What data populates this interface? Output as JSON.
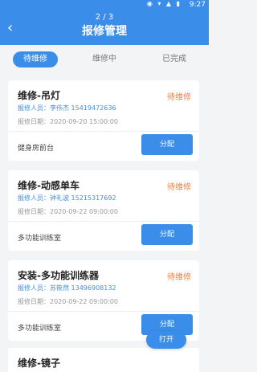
{
  "statusbar": {
    "time": "9:27",
    "icons": "◉ ▾ ▲ ▮"
  },
  "header": {
    "back_icon": "‹",
    "pager": "2 / 3",
    "title": "报修管理"
  },
  "tabs": [
    {
      "label": "待维修"
    },
    {
      "label": "维修中"
    },
    {
      "label": "已完成"
    }
  ],
  "cards": [
    {
      "name": "维修-吊灯",
      "status": "待维修",
      "reporter": "报修人员：李伟杰 15419472636",
      "date": "报修日期：2020-09-20 15:00:00",
      "location": "健身房前台",
      "assign": "分配"
    },
    {
      "name": "维修-动感单车",
      "status": "待维修",
      "reporter": "报修人员：钟礼波 15215317692",
      "date": "报修日期：2020-09-22 09:00:00",
      "location": "多功能训练室",
      "assign": "分配"
    },
    {
      "name": "安装-多功能训练器",
      "status": "待维修",
      "reporter": "报修人员：苏筱然 13496908132",
      "date": "报修日期：2020-09-22 09:00:00",
      "location": "多功能训练室",
      "assign": "分配"
    },
    {
      "name": "维修-镜子"
    }
  ],
  "fab": {
    "label": "打开"
  }
}
